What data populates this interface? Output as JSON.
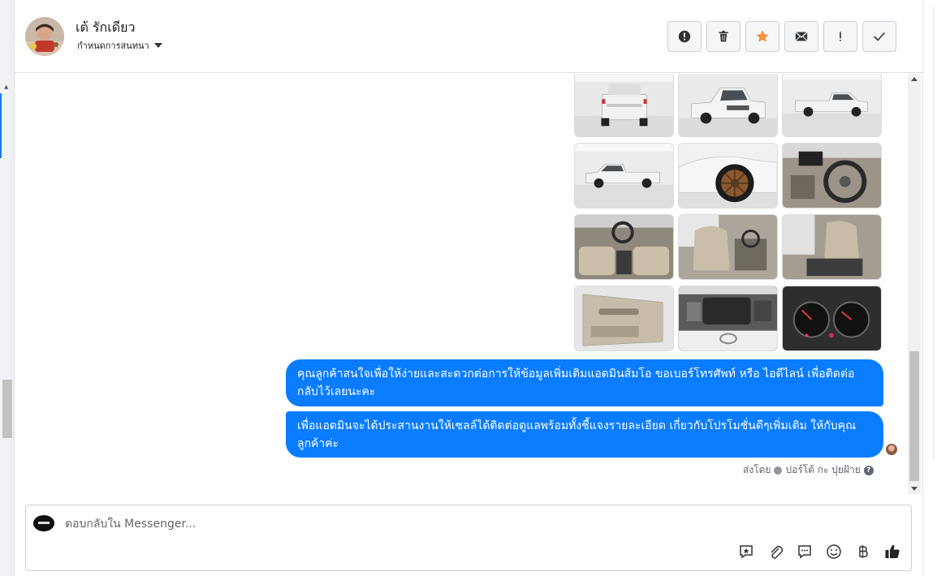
{
  "header": {
    "contact_name": "เต้ รักเดียว",
    "assign_label": "กำหนดการสนทนา"
  },
  "actions": [
    {
      "name": "mark-spam",
      "icon": "alert-circle-icon"
    },
    {
      "name": "delete",
      "icon": "trash-icon"
    },
    {
      "name": "star",
      "icon": "star-icon",
      "color": "#f7923b"
    },
    {
      "name": "mark-unread",
      "icon": "envelope-icon"
    },
    {
      "name": "follow-up",
      "icon": "exclamation-icon"
    },
    {
      "name": "mark-done",
      "icon": "check-icon"
    }
  ],
  "photos": [
    {
      "subject": "truck-rear"
    },
    {
      "subject": "truck-front-three-quarter"
    },
    {
      "subject": "truck-side-right"
    },
    {
      "subject": "truck-side-left"
    },
    {
      "subject": "wheel-closeup"
    },
    {
      "subject": "dashboard-steering"
    },
    {
      "subject": "interior-front"
    },
    {
      "subject": "front-seats"
    },
    {
      "subject": "rear-cab"
    },
    {
      "subject": "door-panel"
    },
    {
      "subject": "engine-bay"
    },
    {
      "subject": "gauge-cluster"
    }
  ],
  "messages": [
    {
      "text": "คุณลูกค้าสนใจเพื่อให้ง่ายและสะดวกต่อการให้ข้อมูลเพิ่มเติมแอดมินส้มโอ ขอเบอร์โทรศัพท์ หรือ ไอดีไลน์ เพื่อติดต่อกลับไว้เลยนะคะ"
    },
    {
      "text": "เพื่อแอดมินจะได้ประสานงานให้เซลล์ได้ติดต่อดูแลพร้อมทั้งชี้แจงรายละเอียด เกี่ยวกับโปรโมชั่นดีๆเพิ่มเติม ให้กับคุณลูกค้าค่ะ"
    }
  ],
  "sent_by": {
    "prefix": "ส่งโดย",
    "name": "ปอร์โต้ กะ ปุยฝ้าย"
  },
  "composer": {
    "placeholder": "ตอบกลับใน Messenger..."
  },
  "colors": {
    "bubble": "#0a7cff",
    "accent": "#1877f2"
  }
}
